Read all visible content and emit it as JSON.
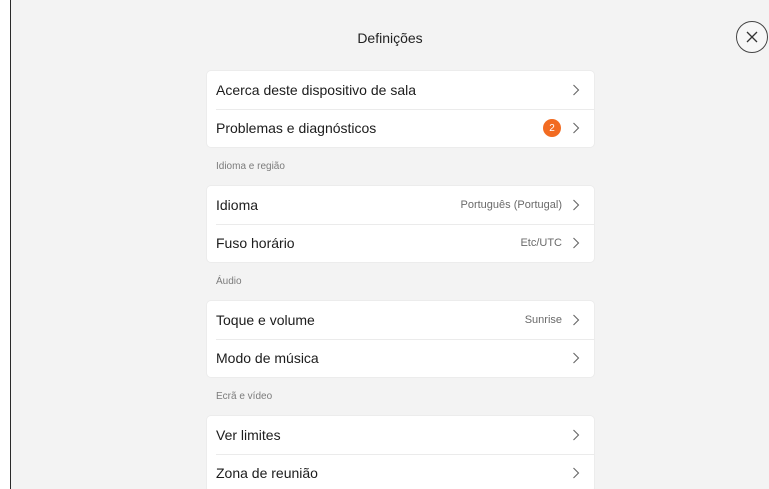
{
  "header": {
    "title": "Definições"
  },
  "icons": {
    "close": "close-icon",
    "chevron": "chevron-right-icon"
  },
  "colors": {
    "badge": "#f26b21",
    "background": "#f3f3f3",
    "card": "#ffffff"
  },
  "groups": [
    {
      "items": [
        {
          "label": "Acerca deste dispositivo de sala"
        },
        {
          "label": "Problemas e diagnósticos",
          "badge": "2"
        }
      ]
    },
    {
      "title": "Idioma e região",
      "items": [
        {
          "label": "Idioma",
          "value": "Português (Portugal)"
        },
        {
          "label": "Fuso horário",
          "value": "Etc/UTC"
        }
      ]
    },
    {
      "title": "Áudio",
      "items": [
        {
          "label": "Toque e volume",
          "value": "Sunrise"
        },
        {
          "label": "Modo de música"
        }
      ]
    },
    {
      "title": "Ecrã e vídeo",
      "items": [
        {
          "label": "Ver limites"
        },
        {
          "label": "Zona de reunião"
        }
      ]
    }
  ]
}
